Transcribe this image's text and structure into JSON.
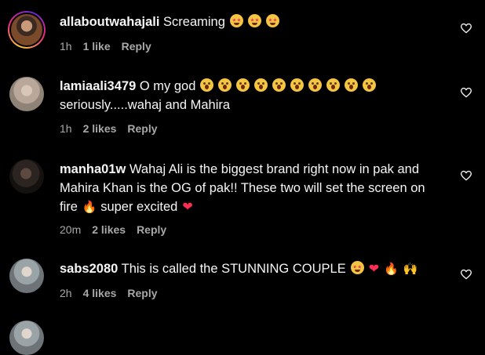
{
  "comments": [
    {
      "username": "allaboutwahajali",
      "text": "Screaming",
      "emojis": [
        "star-struck-emoji",
        "star-struck-emoji",
        "star-struck-emoji"
      ],
      "time": "1h",
      "likes": "1 like",
      "reply": "Reply"
    },
    {
      "username": "lamiaali3479",
      "text": "O my god",
      "emojis": [
        "astonished-emoji",
        "astonished-emoji",
        "astonished-emoji",
        "astonished-emoji",
        "astonished-emoji",
        "astonished-emoji",
        "astonished-emoji",
        "astonished-emoji",
        "astonished-emoji",
        "astonished-emoji"
      ],
      "text2": "seriously.....wahaj and Mahira",
      "time": "1h",
      "likes": "2 likes",
      "reply": "Reply"
    },
    {
      "username": "manha01w",
      "text_line1": "Wahaj Ali is the biggest brand right now in pak and",
      "text_line2": "Mahira Khan is the OG of pak!! These two will set the screen on",
      "text_line3a": "fire",
      "text_line3b": "super excited",
      "time": "20m",
      "likes": "2 likes",
      "reply": "Reply"
    },
    {
      "username": "sabs2080",
      "text": "This is called the STUNNING COUPLE",
      "time": "2h",
      "likes": "4 likes",
      "reply": "Reply"
    }
  ],
  "icons": {
    "like": "heart-outline-icon",
    "heart_color": "#ff2d55",
    "fire_color": "#ff8a00"
  }
}
